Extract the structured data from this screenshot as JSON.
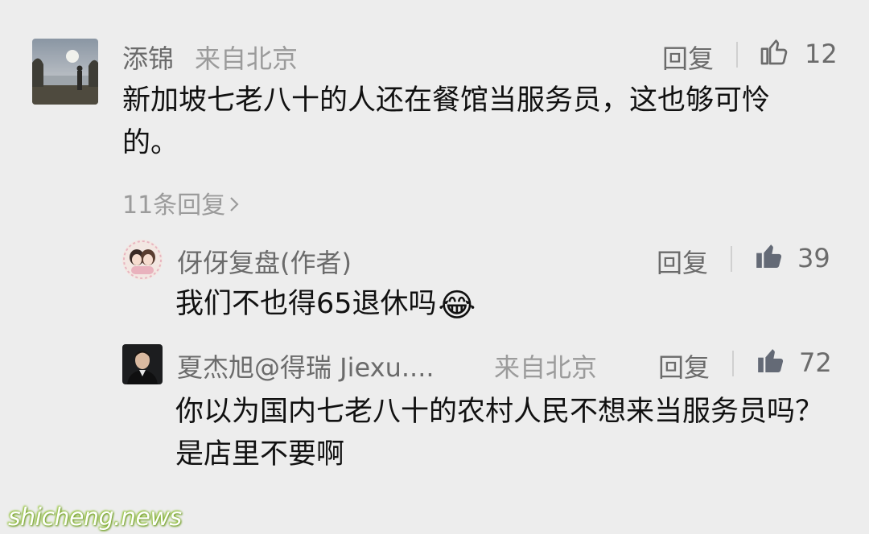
{
  "comments": [
    {
      "author": "添锦",
      "location": "来自北京",
      "reply_label": "回复",
      "like_count": "12",
      "like_icon": "thumbs-up-outline-icon",
      "text": "新加坡七老八十的人还在餐馆当服务员，这也够可怜的。",
      "replies_link": "11条回复"
    }
  ],
  "replies": [
    {
      "author": "伢伢复盘(作者)",
      "reply_label": "回复",
      "like_count": "39",
      "like_icon": "thumbs-up-filled-icon",
      "text": "我们不也得65退休吗",
      "emoji": "😂"
    },
    {
      "author": "夏杰旭@得瑞 Jiexu....",
      "location": "来自北京",
      "reply_label": "回复",
      "like_count": "72",
      "like_icon": "thumbs-up-filled-icon",
      "text": "你以为国内七老八十的农村人民不想来当服务员吗？是店里不要啊"
    }
  ],
  "watermark": "shicheng.news",
  "colors": {
    "background": "#ededed",
    "name": "#6b6b6b",
    "meta": "#9b9b9b",
    "text": "#111111",
    "like_filled": "#646a76",
    "watermark_glow": "#7fb02a"
  }
}
